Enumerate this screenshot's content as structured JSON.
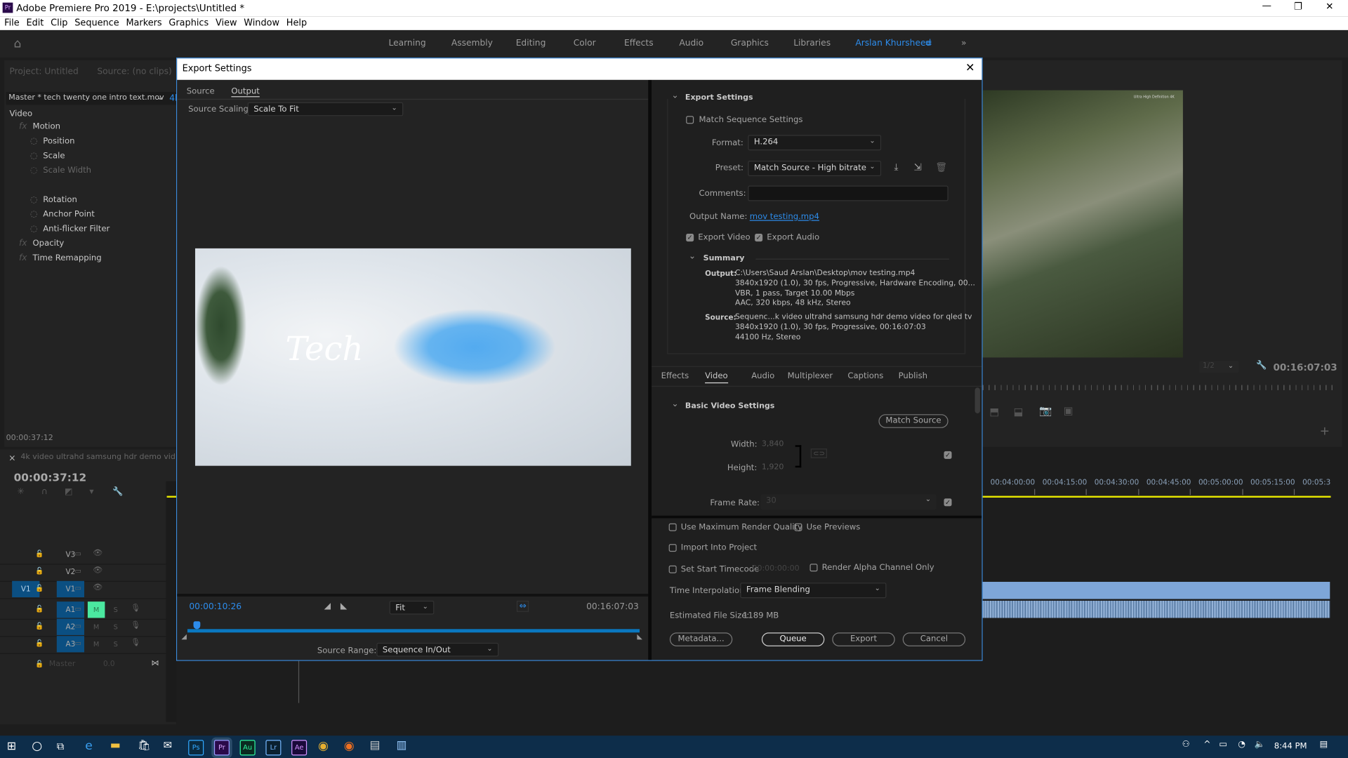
{
  "window": {
    "title": "Adobe Premiere Pro 2019 - E:\\projects\\Untitled *",
    "app_icon": "Pr",
    "controls": [
      "minimize-icon",
      "restore-icon",
      "close-icon"
    ]
  },
  "menu": [
    "File",
    "Edit",
    "Clip",
    "Sequence",
    "Markers",
    "Graphics",
    "View",
    "Window",
    "Help"
  ],
  "workspaces": {
    "items": [
      "Learning",
      "Assembly",
      "Editing",
      "Color",
      "Effects",
      "Audio",
      "Graphics",
      "Libraries"
    ],
    "active": "Arslan Khursheed",
    "overflow": "»",
    "accent": "#2d8ceb"
  },
  "left_panel": {
    "tabs": [
      "Project: Untitled",
      "Source: (no clips)"
    ],
    "clip": "Master * tech twenty one intro text.mov",
    "clip_seq": "4k",
    "section": "Video",
    "effects": [
      {
        "label": "Motion",
        "fx": true
      },
      {
        "label": "Position"
      },
      {
        "label": "Scale"
      },
      {
        "label": "Scale Width",
        "dim": true
      },
      {
        "label": "Rotation"
      },
      {
        "label": "Anchor Point"
      },
      {
        "label": "Anti-flicker Filter"
      },
      {
        "label": "Opacity",
        "fx": true
      },
      {
        "label": "Time Remapping",
        "fx": true
      }
    ],
    "timecode": "00:00:37:12"
  },
  "timeline": {
    "tab": "4k video ultrahd samsung hdr demo video for",
    "timecode": "00:00:37:12",
    "tracks": [
      {
        "id": "V3"
      },
      {
        "id": "V2"
      },
      {
        "id": "V1",
        "src": "V1"
      },
      {
        "id": "A1",
        "m": "M",
        "s": "S"
      },
      {
        "id": "A2",
        "m": "M",
        "s": "S"
      },
      {
        "id": "A3",
        "m": "M",
        "s": "S"
      }
    ],
    "master": {
      "label": "Master",
      "value": "0.0"
    },
    "ruler": [
      "00:04:00:00",
      "00:04:15:00",
      "00:04:30:00",
      "00:04:45:00",
      "00:05:00:00",
      "00:05:15:00",
      "00:05:3"
    ]
  },
  "program": {
    "resolution": "1/2",
    "duration": "00:16:07:03",
    "frame_caption": "Ultra High Definition 4K"
  },
  "dialog": {
    "title": "Export Settings",
    "tabs": [
      "Source",
      "Output"
    ],
    "active_tab": "Output",
    "source_scaling_label": "Source Scaling:",
    "source_scaling": "Scale To Fit",
    "preview_text": "Tech",
    "current_time": "00:00:10:26",
    "duration": "00:16:07:03",
    "zoom": "Fit",
    "playhead_fraction": 0.011,
    "source_range_label": "Source Range:",
    "source_range": "Sequence In/Out",
    "export_settings": {
      "header": "Export Settings",
      "match_sequence": "Match Sequence Settings",
      "match_sequence_checked": false,
      "format_label": "Format:",
      "format": "H.264",
      "preset_label": "Preset:",
      "preset": "Match Source - High bitrate",
      "comments_label": "Comments:",
      "comments": "",
      "output_name_label": "Output Name:",
      "output_name": "mov testing.mp4",
      "export_video": "Export Video",
      "export_video_checked": true,
      "export_audio": "Export Audio",
      "export_audio_checked": true,
      "summary_header": "Summary",
      "output_label": "Output:",
      "output_lines": [
        "C:\\Users\\Saud Arslan\\Desktop\\mov testing.mp4",
        "3840x1920 (1.0), 30 fps, Progressive, Hardware Encoding, 00...",
        "VBR, 1 pass, Target 10.00 Mbps",
        "AAC, 320 kbps, 48 kHz, Stereo"
      ],
      "source_label": "Source:",
      "source_lines": [
        "Sequenc...k video ultrahd samsung hdr demo video for qled tv",
        "3840x1920 (1.0), 30 fps, Progressive, 00:16:07:03",
        "44100 Hz, Stereo"
      ]
    },
    "settings_tabs": [
      "Effects",
      "Video",
      "Audio",
      "Multiplexer",
      "Captions",
      "Publish"
    ],
    "settings_active": "Video",
    "video": {
      "header": "Basic Video Settings",
      "match_source": "Match Source",
      "width_label": "Width:",
      "width": "3,840",
      "height_label": "Height:",
      "height": "1,920",
      "frame_rate_label": "Frame Rate:",
      "frame_rate": "30"
    },
    "options": {
      "max_render": "Use Maximum Render Quality",
      "use_previews": "Use Previews",
      "import_project": "Import Into Project",
      "start_tc": "Set Start Timecode",
      "start_tc_value": "00:00:00:00",
      "alpha": "Render Alpha Channel Only",
      "interp_label": "Time Interpolation:",
      "interp": "Frame Blending",
      "size_label": "Estimated File Size:",
      "size": "1189 MB"
    },
    "buttons": {
      "metadata": "Metadata...",
      "queue": "Queue",
      "export": "Export",
      "cancel": "Cancel"
    }
  },
  "taskbar": {
    "apps": [
      "Ps",
      "Pr",
      "Au",
      "Lr",
      "Ae"
    ],
    "time": "8:44 PM"
  }
}
